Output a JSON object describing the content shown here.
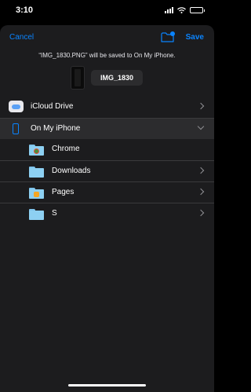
{
  "status": {
    "time": "3:10"
  },
  "nav": {
    "cancel": "Cancel",
    "save": "Save"
  },
  "save_message": "“IMG_1830.PNG” will be saved to On My iPhone.",
  "file": {
    "name": "IMG_1830"
  },
  "locations": [
    {
      "label": "iCloud Drive"
    },
    {
      "label": "On My iPhone"
    }
  ],
  "folders": [
    {
      "label": "Chrome"
    },
    {
      "label": "Downloads"
    },
    {
      "label": "Pages"
    },
    {
      "label": "S"
    }
  ],
  "colors": {
    "accent": "#0a84ff",
    "sheet": "#1c1c1e",
    "folder": "#8dd0f2"
  }
}
